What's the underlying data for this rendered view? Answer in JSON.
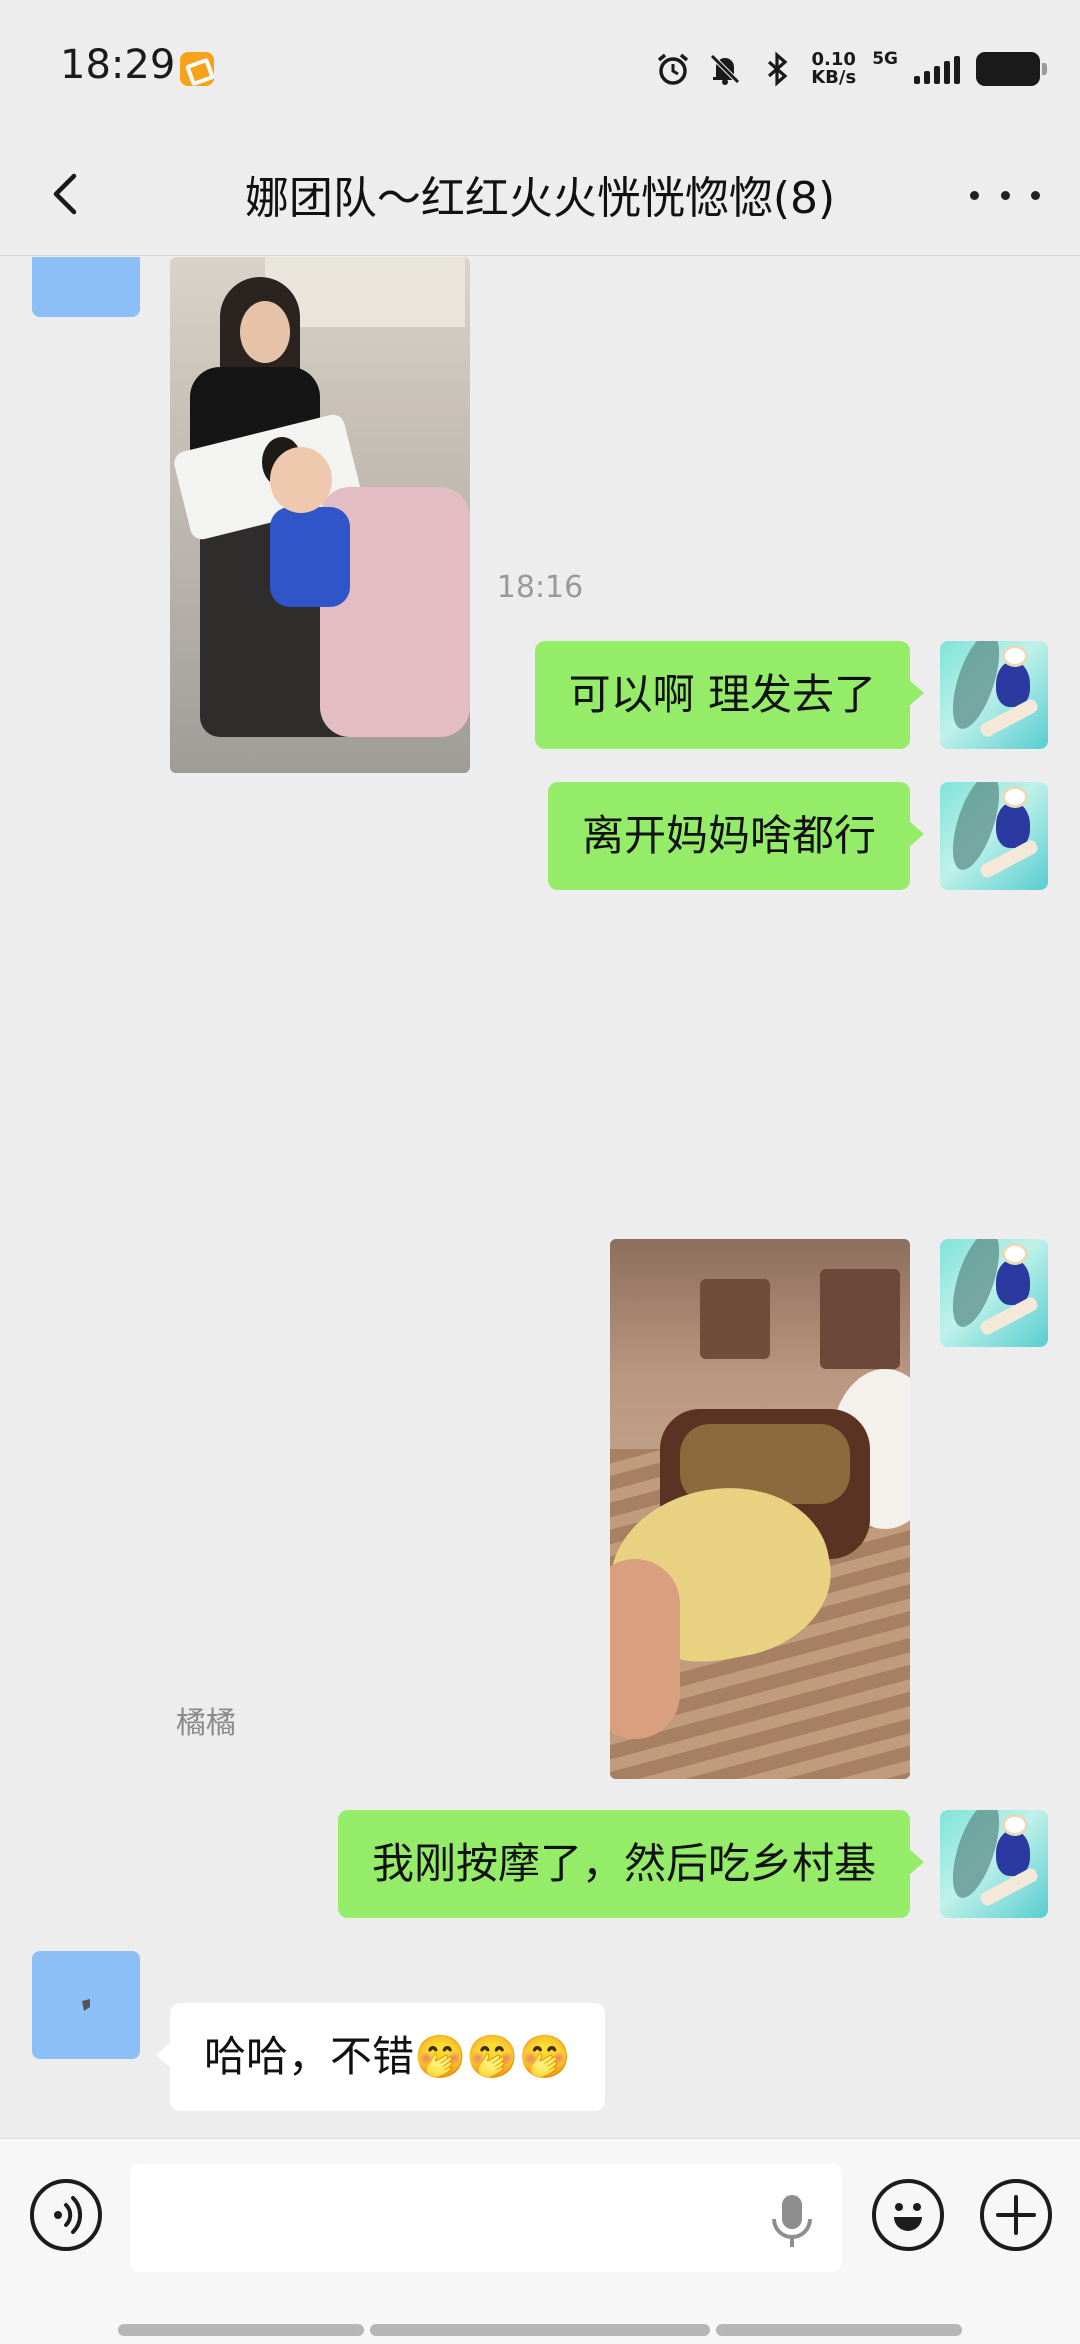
{
  "status_bar": {
    "time": "18:29",
    "net_speed_value": "0.10",
    "net_speed_unit": "KB/s",
    "network": "5G",
    "icons": [
      "alarm-icon",
      "bell-off-icon",
      "bluetooth-icon",
      "signal-icon",
      "battery-icon"
    ]
  },
  "header": {
    "title": "娜团队～红红火火恍恍惚惚(8)",
    "back_icon": "chevron-left-icon",
    "more_icon": "more-dots-icon"
  },
  "chat": {
    "timestamp": "18:16",
    "messages": [
      {
        "from": "me",
        "type": "text",
        "text": "可以啊 理发去了"
      },
      {
        "from": "me",
        "type": "text",
        "text": "离开妈妈啥都行"
      },
      {
        "from": "me",
        "type": "image"
      },
      {
        "from": "me",
        "type": "text",
        "text": "我刚按摩了，然后吃乡村基"
      },
      {
        "from": "other",
        "sender": "橘橘",
        "type": "text",
        "text": "哈哈，不错🤭🤭🤭"
      }
    ]
  },
  "input_bar": {
    "value": "",
    "placeholder": "",
    "voice_icon": "voice-icon",
    "mic_icon": "microphone-icon",
    "emoji_icon": "emoji-icon",
    "plus_icon": "plus-icon"
  },
  "colors": {
    "background": "#ededed",
    "bubble_me": "#95ec69",
    "bubble_other": "#ffffff",
    "avatar_placeholder": "#8cbff5"
  }
}
